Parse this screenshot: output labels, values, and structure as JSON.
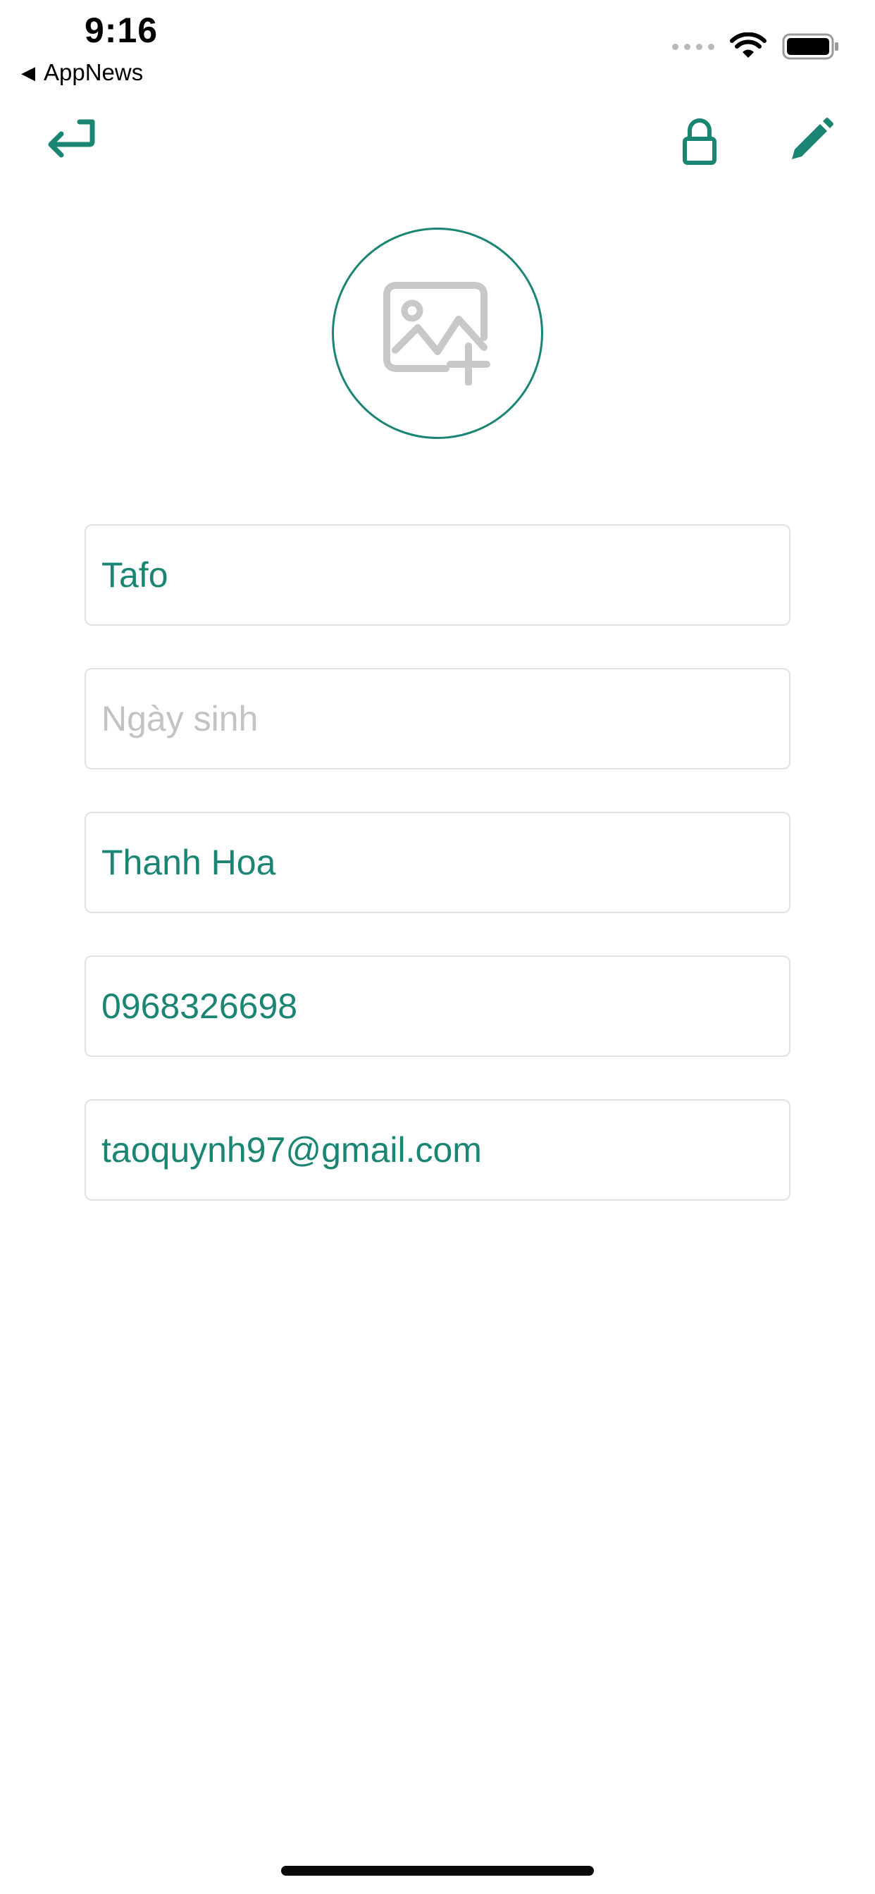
{
  "status_bar": {
    "time": "9:16",
    "back_app": "AppNews",
    "icons": [
      "signal-dots-icon",
      "wifi-icon",
      "battery-icon"
    ]
  },
  "nav": {
    "back_icon": "return-arrow-icon",
    "lock_icon": "lock-icon",
    "edit_icon": "pencil-icon"
  },
  "avatar": {
    "icon": "add-image-icon"
  },
  "form": {
    "name": {
      "value": "Tafo",
      "placeholder": ""
    },
    "birthday": {
      "value": "",
      "placeholder": "Ngày sinh"
    },
    "city": {
      "value": "Thanh Hoa",
      "placeholder": ""
    },
    "phone": {
      "value": "0968326698",
      "placeholder": ""
    },
    "email": {
      "value": "taoquynh97@gmail.com",
      "placeholder": ""
    }
  },
  "colors": {
    "accent": "#1b8574",
    "placeholder": "#c3c3c3",
    "border": "#e2e2e2",
    "icon_gray": "#c8c8c8"
  }
}
